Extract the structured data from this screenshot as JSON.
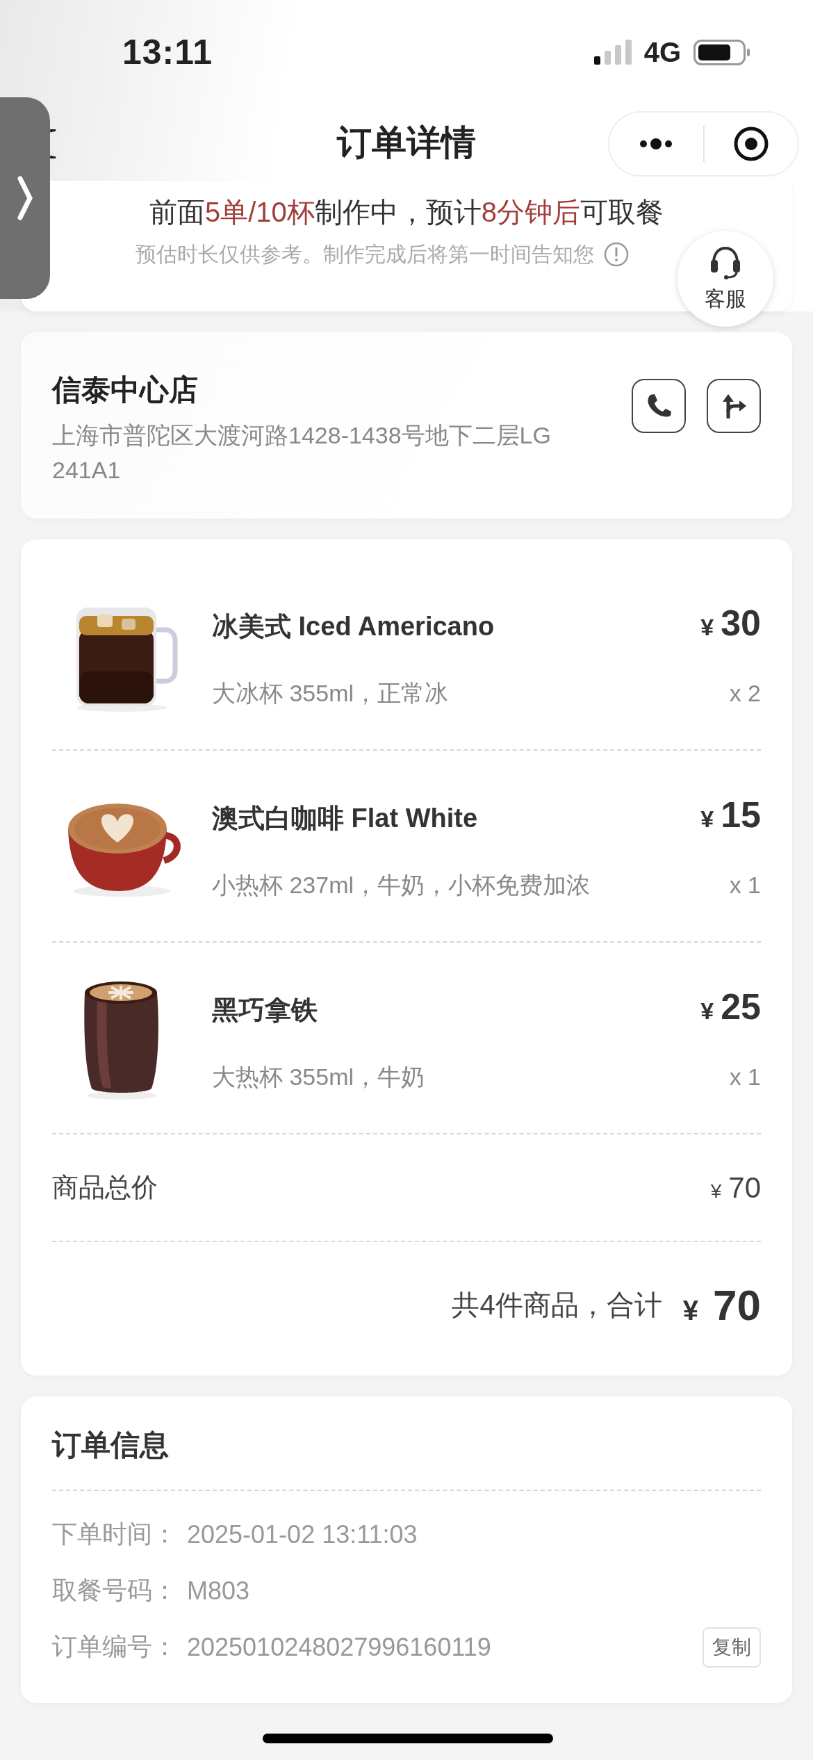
{
  "status_bar": {
    "time": "13:11",
    "network": "4G"
  },
  "nav": {
    "title": "订单详情"
  },
  "eta": {
    "segments": [
      {
        "text": "前面",
        "highlight": false
      },
      {
        "text": "5单/10杯",
        "highlight": true
      },
      {
        "text": "制作中，预计",
        "highlight": false
      },
      {
        "text": "8分钟后",
        "highlight": true
      },
      {
        "text": "可取餐",
        "highlight": false
      }
    ],
    "note": "预估时长仅供参考。制作完成后将第一时间告知您"
  },
  "support": {
    "label": "客服"
  },
  "store": {
    "name": "信泰中心店",
    "address": "上海市普陀区大渡河路1428-1438号地下二层LG241A1"
  },
  "items": [
    {
      "name": "冰美式 Iced Americano",
      "currency": "¥",
      "price": "30",
      "options": "大冰杯 355ml，正常冰",
      "quantity": "x 2"
    },
    {
      "name": "澳式白咖啡 Flat White",
      "currency": "¥",
      "price": "15",
      "options": "小热杯 237ml，牛奶，小杯免费加浓",
      "quantity": "x 1"
    },
    {
      "name": "黑巧拿铁",
      "currency": "¥",
      "price": "25",
      "options": "大热杯 355ml，牛奶",
      "quantity": "x 1"
    }
  ],
  "subtotal": {
    "label": "商品总价",
    "currency": "¥",
    "amount": "70"
  },
  "total": {
    "label": "共4件商品，合计",
    "currency": "¥",
    "amount": "70"
  },
  "order_info": {
    "title": "订单信息",
    "rows": [
      {
        "label": "下单时间：",
        "value": "2025-01-02 13:11:03"
      },
      {
        "label": "取餐号码：",
        "value": "M803"
      },
      {
        "label": "订单编号：",
        "value": "2025010248027996160119",
        "action": "复制"
      }
    ]
  }
}
